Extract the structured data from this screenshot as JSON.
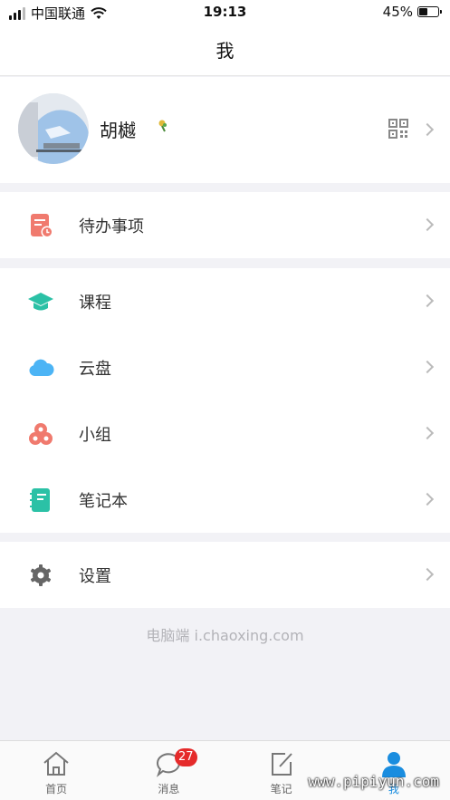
{
  "status_bar": {
    "carrier": "中国联通",
    "time": "19:13",
    "battery_percent": "45%",
    "battery_level": 0.45
  },
  "nav": {
    "title": "我"
  },
  "profile": {
    "name": "胡樾",
    "qr_icon": "qr-code-icon"
  },
  "menu": {
    "todo": {
      "label": "待办事项",
      "icon": "todo-icon",
      "color": "#f07a6e"
    },
    "courses": {
      "label": "课程",
      "icon": "graduation-cap-icon",
      "color": "#2bc1a6"
    },
    "cloud": {
      "label": "云盘",
      "icon": "cloud-icon",
      "color": "#4cb4f5"
    },
    "groups": {
      "label": "小组",
      "icon": "group-icon",
      "color": "#f07a6e"
    },
    "notebook": {
      "label": "笔记本",
      "icon": "notebook-icon",
      "color": "#2bc1a6"
    },
    "settings": {
      "label": "设置",
      "icon": "gear-icon",
      "color": "#666666"
    }
  },
  "footer": {
    "pc_link": "电脑端 i.chaoxing.com"
  },
  "tabs": {
    "home": {
      "label": "首页"
    },
    "messages": {
      "label": "消息",
      "unread": "27"
    },
    "notes": {
      "label": "笔记"
    },
    "me": {
      "label": "我"
    }
  },
  "watermark": "www.pipiyun.com",
  "accent_color": "#1a8ddf"
}
